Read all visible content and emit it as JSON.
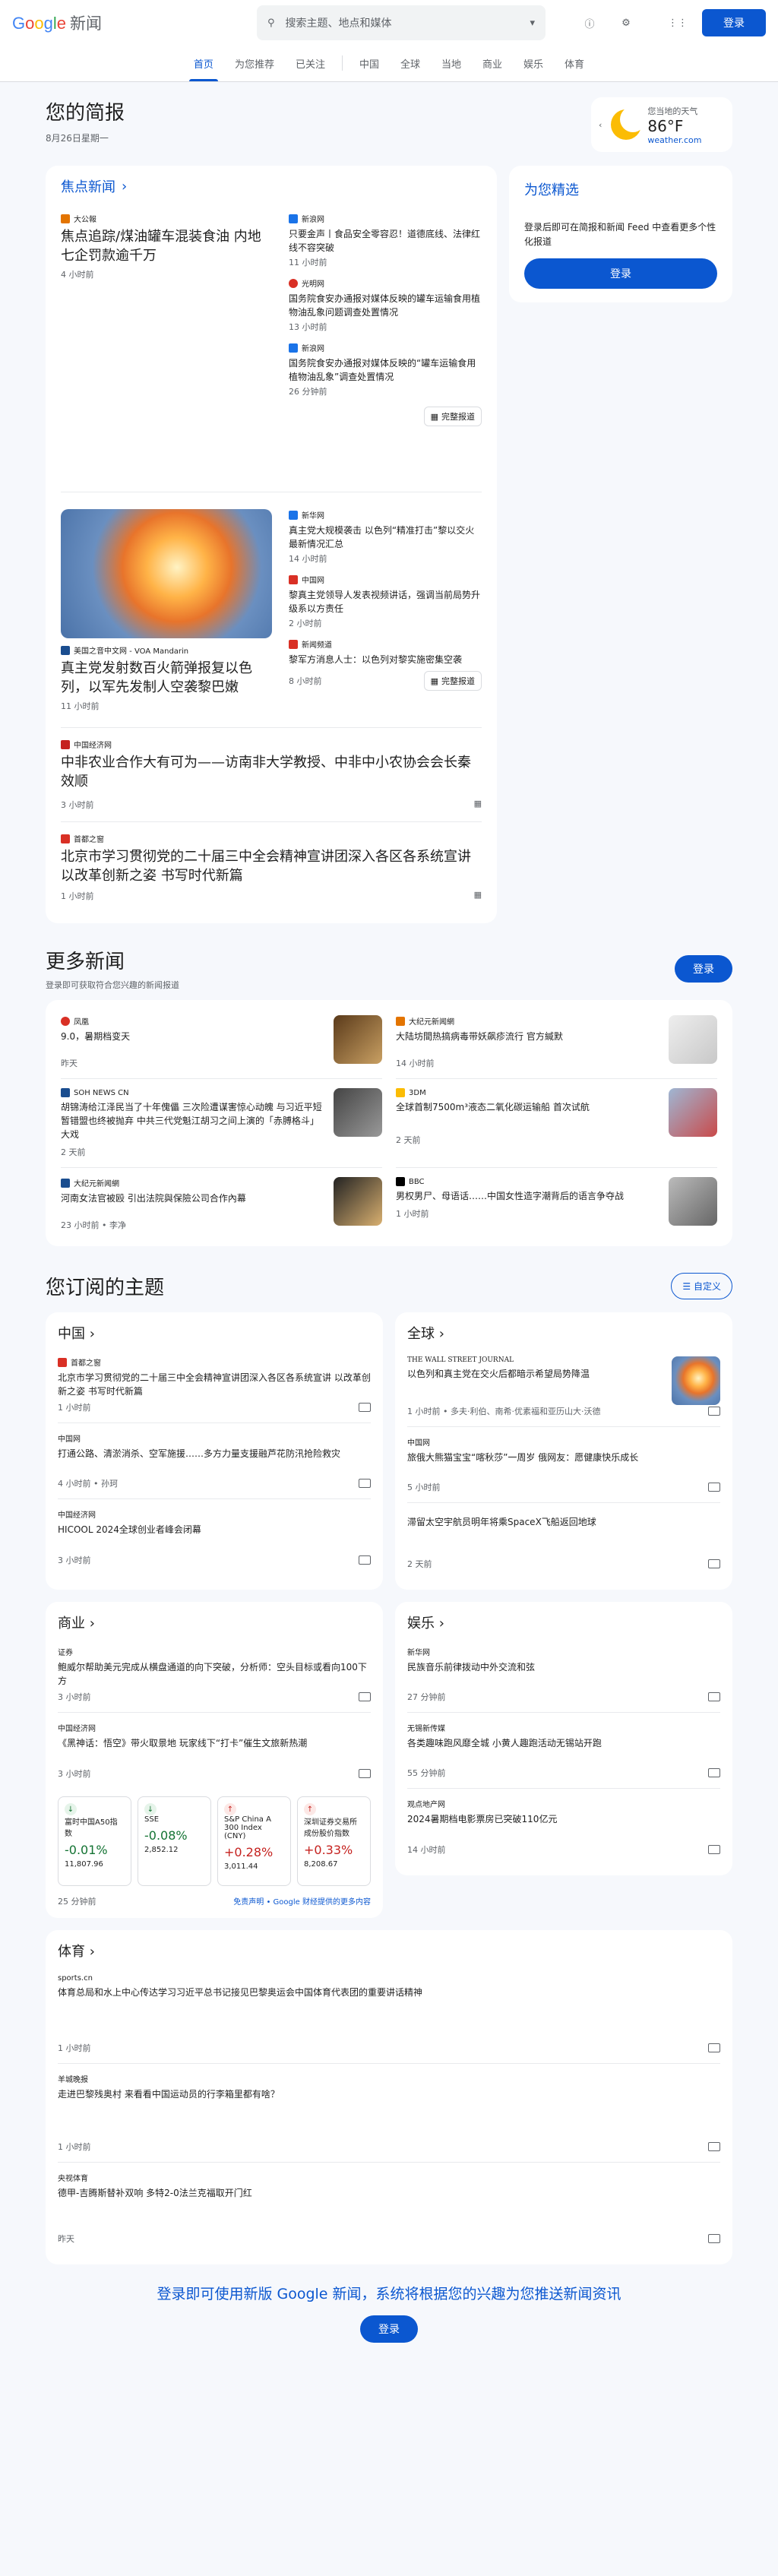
{
  "header": {
    "logo_google": "Google",
    "logo_news": "新闻",
    "search_placeholder": "搜索主题、地点和媒体",
    "signin": "登录"
  },
  "nav": {
    "tabs": [
      "首页",
      "为您推荐",
      "已关注"
    ],
    "sections": [
      "中国",
      "全球",
      "当地",
      "商业",
      "娱乐",
      "体育"
    ]
  },
  "brief": {
    "title": "您的简报",
    "date": "8月26日星期一"
  },
  "weather": {
    "label": "您当地的天气",
    "temp": "86°F",
    "source": "weather.com"
  },
  "top": {
    "title": "焦点新闻",
    "c1": {
      "src": "大公報",
      "headline": "焦点追踪/煤油罐车混装食油 内地七企罚款逾千万",
      "time": "4 小时前",
      "side": [
        {
          "src": "新浪网",
          "title": "只要金声丨食品安全零容忍！道德底线、法律红线不容突破",
          "time": "11 小时前"
        },
        {
          "src": "光明网",
          "title": "国务院食安办通报对媒体反映的罐车运输食用植物油乱象问题调查处置情况",
          "time": "13 小时前"
        },
        {
          "src": "新浪网",
          "title": "国务院食安办通报对媒体反映的“罐车运输食用植物油乱象”调查处置情况",
          "time": "26 分钟前"
        }
      ],
      "full": "完整报道"
    },
    "c2": {
      "src": "美国之音中文网 - VOA Mandarin",
      "headline": "真主党发射数百火箭弹报复以色列，以军先发制人空袭黎巴嫩",
      "time": "11 小时前",
      "side": [
        {
          "src": "新华网",
          "title": "真主党大规模袭击 以色列“精准打击”黎以交火最新情况汇总",
          "time": "14 小时前"
        },
        {
          "src": "中国网",
          "title": "黎真主党领导人发表视频讲话，强调当前局势升级系以方责任",
          "time": "2 小时前"
        },
        {
          "src": "新闻频道",
          "title": "黎军方消息人士：以色列对黎实施密集空袭",
          "time": "8 小时前"
        }
      ],
      "full": "完整报道"
    },
    "s1": {
      "src": "中国经济网",
      "headline": "中非农业合作大有可为——访南非大学教授、中非中小农协会会长秦效顺",
      "time": "3 小时前"
    },
    "s2": {
      "src": "首都之窗",
      "headline": "北京市学习贯彻党的二十届三中全会精神宣讲团深入各区各系统宣讲 以改革创新之姿 书写时代新篇",
      "time": "1 小时前"
    }
  },
  "picks": {
    "title": "为您精选",
    "desc": "登录后即可在简报和新闻 Feed 中查看更多个性化报道",
    "btn": "登录"
  },
  "more": {
    "title": "更多新闻",
    "desc": "登录即可获取符合您兴趣的新闻报道",
    "btn": "登录",
    "items": [
      {
        "src": "凤凰",
        "title": "9.0，暑期档变天",
        "time": "昨天"
      },
      {
        "src": "大纪元新闻網",
        "title": "大陆坊間热搞病毒带妖飙疹流行 官方緘默",
        "time": "14 小时前"
      },
      {
        "src": "SOH NEWS CN",
        "title": "胡锦涛给江泽民当了十年傀儡 三次险遭谋害惊心动魄 与习近平短暂错盟也终被抛弃 中共三代党魁江胡习之间上演的「赤膊格斗」大戏",
        "time": "2 天前"
      },
      {
        "src": "3DM",
        "title": "全球首制7500m³液态二氧化碳运输船 首次试航",
        "time": "2 天前"
      },
      {
        "src": "大纪元新闻網",
        "title": "河南女法官被殴 引出法院與保險公司合作內幕",
        "time": "23 小时前 • 李净"
      },
      {
        "src": "BBC",
        "title": "男权男尸、母语话……中国女性造字潮背后的语言争夺战",
        "time": "1 小时前"
      }
    ]
  },
  "topics": {
    "title": "您订阅的主题",
    "customize": "自定义",
    "china": {
      "title": "中国",
      "items": [
        {
          "src": "首都之窗",
          "title": "北京市学习贯彻党的二十届三中全会精神宣讲团深入各区各系统宣讲 以改革创新之姿 书写时代新篇",
          "time": "1 小时前"
        },
        {
          "src": "中国网",
          "title": "打通公路、清淤消杀、空军施援……多方力量支援融芦花防汛抢险救灾",
          "time": "4 小时前 • 孙珂"
        },
        {
          "src": "中国经济网",
          "title": "HICOOL 2024全球创业者峰会闭幕",
          "time": "3 小时前"
        }
      ]
    },
    "world": {
      "title": "全球",
      "items": [
        {
          "src": "THE WALL STREET JOURNAL",
          "title": "以色列和真主党在交火后都暗示希望局势降温",
          "time": "1 小时前 • 多夫·利伯、南希·优素福和亚历山大·沃德"
        },
        {
          "src": "中国网",
          "title": "旅俄大熊猫宝宝“喀秋莎”一周岁 俄网友：愿健康快乐成长",
          "time": "5 小时前"
        },
        {
          "src": "",
          "title": "滞留太空宇航员明年将乘SpaceX飞船返回地球",
          "time": "2 天前"
        }
      ]
    },
    "business": {
      "title": "商业",
      "items": [
        {
          "src": "证券",
          "title": "鲍威尔帮助美元完成从横盘通道的向下突破，分析师：空头目标或看向100下方",
          "time": "3 小时前"
        },
        {
          "src": "中国经济网",
          "title": "《黑神话：悟空》带火取景地 玩家线下“打卡”催生文旅新热潮",
          "time": "3 小时前"
        }
      ],
      "stocks": [
        {
          "name": "富时中国A50指数",
          "chg": "-0.01%",
          "val": "11,807.96",
          "up": false
        },
        {
          "name": "SSE",
          "chg": "-0.08%",
          "val": "2,852.12",
          "up": false
        },
        {
          "name": "S&P China A 300 Index (CNY)",
          "chg": "+0.28%",
          "val": "3,011.44",
          "up": true
        },
        {
          "name": "深圳证券交易所成份股价指数",
          "chg": "+0.33%",
          "val": "8,208.67",
          "up": true
        }
      ],
      "stock_time": "25 分钟前",
      "disclaimer": "免责声明 • Google 财经提供的更多内容"
    },
    "ent": {
      "title": "娱乐",
      "items": [
        {
          "src": "新华网",
          "title": "民族音乐前律拨动中外交流和弦",
          "time": "27 分钟前"
        },
        {
          "src": "无锡新传媒",
          "title": "各类趣味跑风靡全城 小黄人趣跑活动无锡站开跑",
          "time": "55 分钟前"
        },
        {
          "src": "观点地产网",
          "title": "2024暑期档电影票房已突破110亿元",
          "time": "14 小时前"
        }
      ]
    },
    "sports": {
      "title": "体育",
      "items": [
        {
          "src": "sports.cn",
          "title": "体育总局和水上中心传达学习习近平总书记接见巴黎奥运会中国体育代表团的重要讲话精神",
          "time": "1 小时前"
        },
        {
          "src": "羊城晚报",
          "title": "走进巴黎残奥村 来看看中国运动员的行李箱里都有啥？",
          "time": "1 小时前"
        },
        {
          "src": "央视体育",
          "title": "德甲-吉腾斯替补双响 多特2-0法兰克福取开门红",
          "time": "昨天"
        }
      ]
    }
  },
  "footer": {
    "text": "登录即可使用新版 Google 新闻，系统将根据您的兴趣为您推送新闻资讯",
    "btn": "登录"
  }
}
